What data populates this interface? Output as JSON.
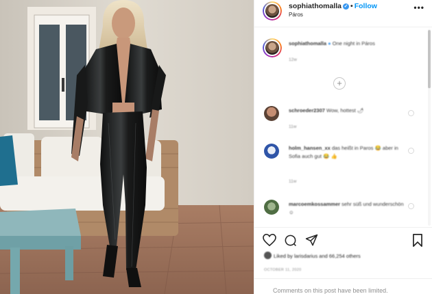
{
  "header": {
    "username": "sophiathomalla",
    "follow_label": "Follow",
    "separator": "•",
    "location": "Páros",
    "more_label": "•••"
  },
  "caption": {
    "username": "sophiathomalla",
    "text": "One night in Páros",
    "time": "12w"
  },
  "load_more_label": "+",
  "comments": [
    {
      "username": "schroeder2307",
      "text": "Wow, hottest 🌶",
      "time": "11w"
    },
    {
      "username": "holm_hansen_xx",
      "text": "das heißt in Paros 😂 aber in Sofia auch gut 😂 👍",
      "time": "11w"
    },
    {
      "username": "marcoemkossammer",
      "text": "sehr süß und wunderschön ☺",
      "time": ""
    }
  ],
  "likes": {
    "text": "Liked by larisdarius and 66,254 others"
  },
  "post_date": "OCTOBER 11, 2020",
  "comments_limited": "Comments on this post have been limited.",
  "icons": [
    "heart-icon",
    "comment-icon",
    "share-icon",
    "bookmark-icon",
    "verified-icon",
    "more-options-icon"
  ],
  "colors": {
    "follow": "#0095f6",
    "verified": "#3897f0",
    "border": "#efefef"
  }
}
